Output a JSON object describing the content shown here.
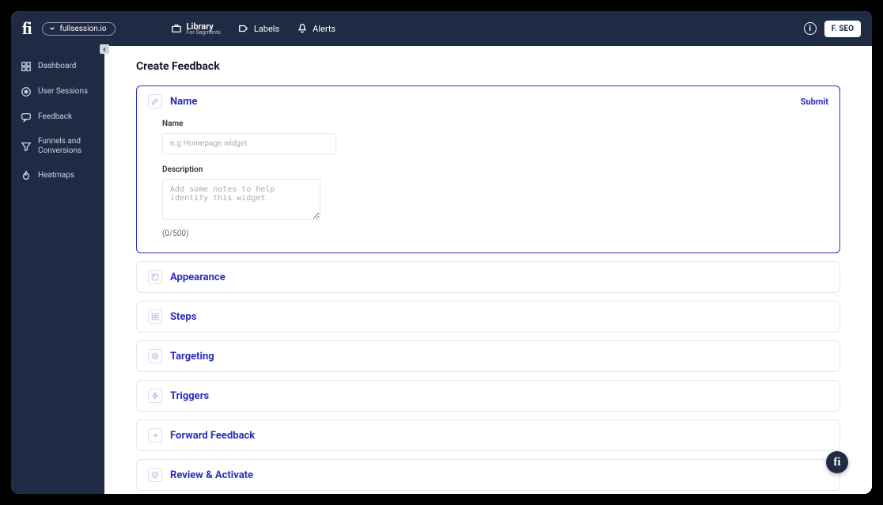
{
  "brand": {
    "logo_text": "fi"
  },
  "site_selector": {
    "label": "fullsession.io"
  },
  "top_nav": {
    "library": {
      "label": "Library",
      "subtitle": "For Segments"
    },
    "labels": {
      "label": "Labels"
    },
    "alerts": {
      "label": "Alerts"
    }
  },
  "user": {
    "initials": "F. SEO"
  },
  "sidebar": {
    "dashboard": "Dashboard",
    "user_sessions": "User Sessions",
    "feedback": "Feedback",
    "funnels": "Funnels and Conversions",
    "heatmaps": "Heatmaps"
  },
  "page": {
    "title": "Create Feedback"
  },
  "sections": {
    "name": {
      "title": "Name",
      "submit": "Submit",
      "fields": {
        "name_label": "Name",
        "name_placeholder": "e.g Homepage widget",
        "name_value": "",
        "desc_label": "Description",
        "desc_placeholder": "Add some notes to help identify this widget",
        "desc_value": "",
        "counter": "(0/500)"
      }
    },
    "appearance": {
      "title": "Appearance"
    },
    "steps": {
      "title": "Steps"
    },
    "targeting": {
      "title": "Targeting"
    },
    "triggers": {
      "title": "Triggers"
    },
    "forward": {
      "title": "Forward Feedback"
    },
    "review": {
      "title": "Review & Activate"
    }
  },
  "floating": {
    "text": "fi"
  }
}
